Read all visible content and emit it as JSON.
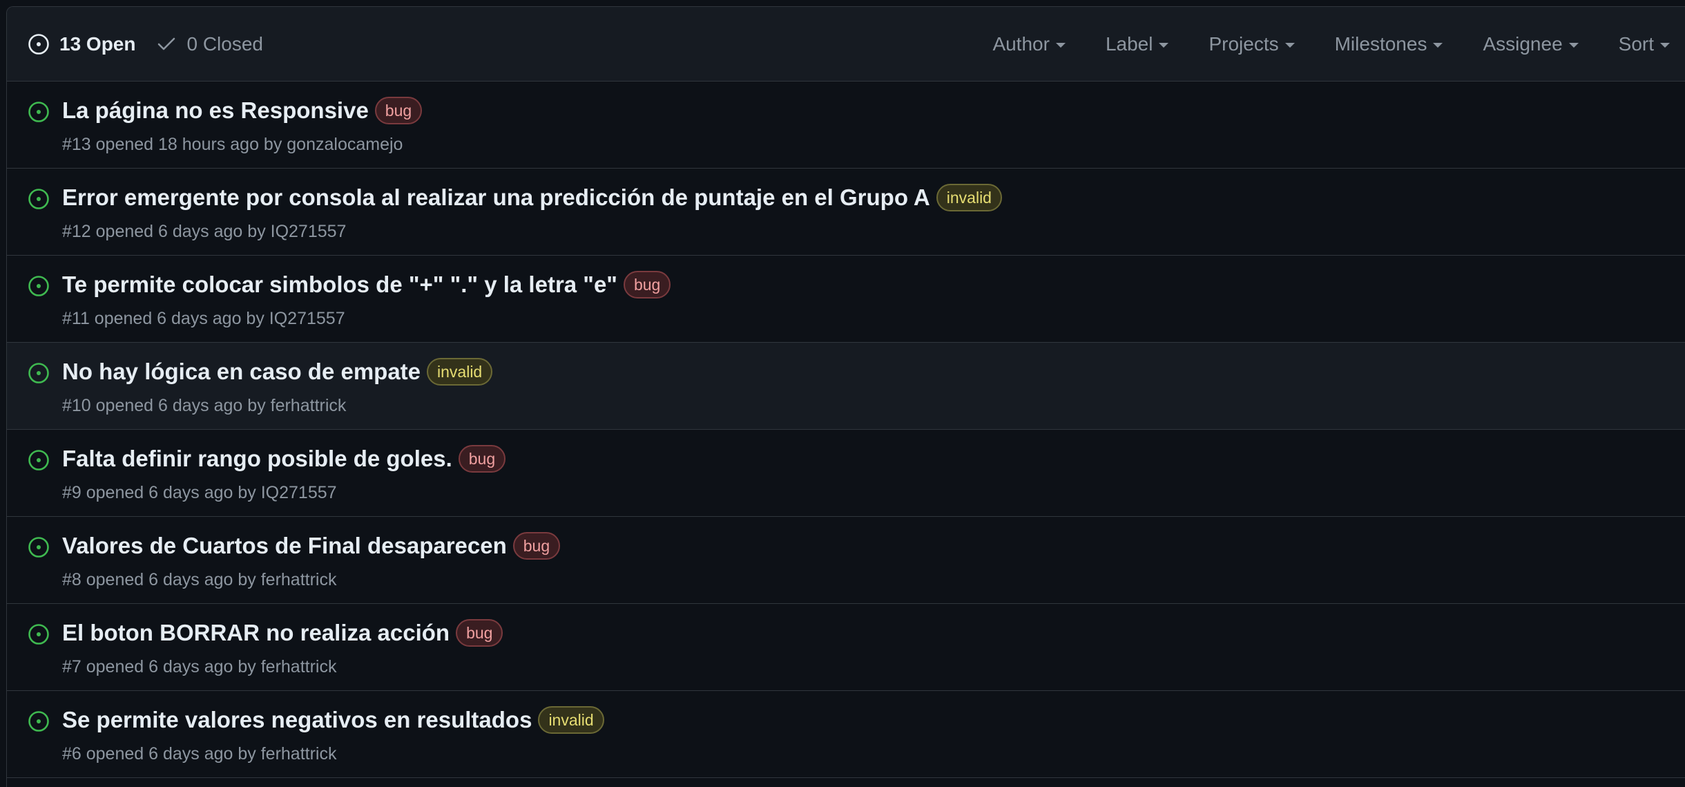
{
  "states": {
    "open_label": "13 Open",
    "closed_label": "0 Closed"
  },
  "filters": [
    {
      "label": "Author"
    },
    {
      "label": "Label"
    },
    {
      "label": "Projects"
    },
    {
      "label": "Milestones"
    },
    {
      "label": "Assignee"
    },
    {
      "label": "Sort"
    }
  ],
  "colors": {
    "open_icon": "#3fb950",
    "bug_text": "#f0a0a0",
    "invalid_text": "#e6dd72"
  },
  "issues": [
    {
      "title": "La página no es Responsive",
      "label": "bug",
      "meta": "#13 opened 18 hours ago by gonzalocamejo"
    },
    {
      "title": "Error emergente por consola al realizar una predicción de puntaje en el Grupo A",
      "label": "invalid",
      "meta": "#12 opened 6 days ago by IQ271557"
    },
    {
      "title": "Te permite colocar simbolos de \"+\" \".\" y la letra \"e\"",
      "label": "bug",
      "meta": "#11 opened 6 days ago by IQ271557"
    },
    {
      "title": "No hay lógica en caso de empate",
      "label": "invalid",
      "meta": "#10 opened 6 days ago by ferhattrick"
    },
    {
      "title": "Falta definir rango posible de goles.",
      "label": "bug",
      "meta": "#9 opened 6 days ago by IQ271557"
    },
    {
      "title": "Valores de Cuartos de Final desaparecen",
      "label": "bug",
      "meta": "#8 opened 6 days ago by ferhattrick"
    },
    {
      "title": "El boton BORRAR no realiza acción",
      "label": "bug",
      "meta": "#7 opened 6 days ago by ferhattrick"
    },
    {
      "title": "Se permite valores negativos en resultados",
      "label": "invalid",
      "meta": "#6 opened 6 days ago by ferhattrick"
    }
  ]
}
